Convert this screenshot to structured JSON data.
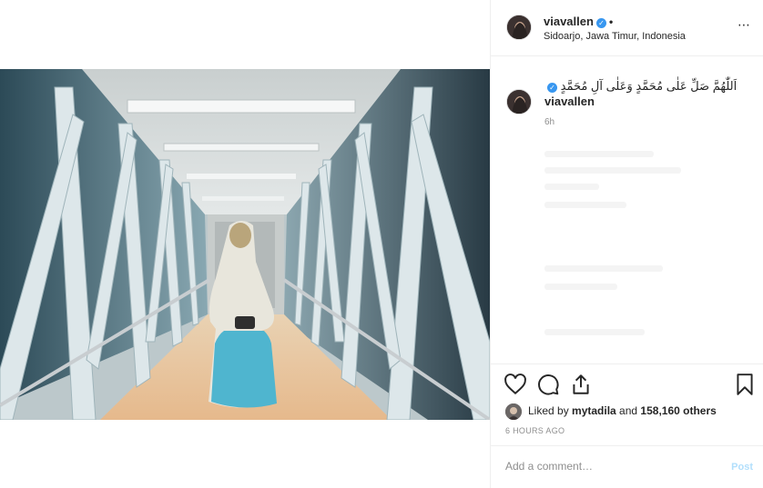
{
  "post": {
    "username": "viavallen",
    "location": "Sidoarjo, Jawa Timur, Indonesia",
    "caption_username": "viavallen",
    "caption_text": "اَللّٰهُمَّ صَلِّ عَلٰى مُحَمَّدٍ وَعَلٰى آلِ مُحَمَّدٍ",
    "caption_age": "6h",
    "more_icon": "⋯",
    "verified_icon": "✓"
  },
  "engagement": {
    "liked_prefix": "Liked by ",
    "liked_user": "mytadila",
    "liked_mid": " and ",
    "liked_count": "158,160 others",
    "timestamp": "6 HOURS AGO"
  },
  "comment": {
    "placeholder": "Add a comment…",
    "post_label": "Post"
  },
  "icons": {
    "like": "heart-icon",
    "comment": "comment-bubble-icon",
    "share": "share-icon",
    "save": "bookmark-icon"
  },
  "colors": {
    "verified": "#3897f0",
    "post_disabled": "#b2dffc",
    "muted": "#8e8e8e",
    "border": "#efefef"
  }
}
